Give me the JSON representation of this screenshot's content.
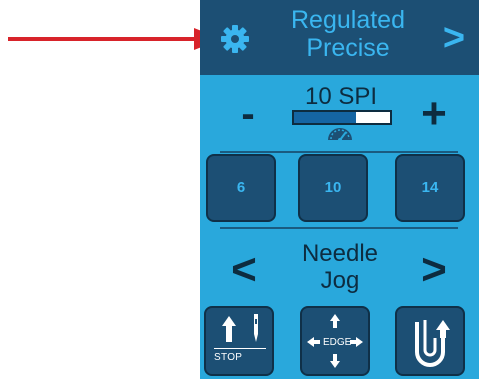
{
  "annotation": {
    "pointer_arrow_color": "#d8232a"
  },
  "colors": {
    "panel_bg": "#29a8dc",
    "button_bg": "#1c4f74",
    "accent_text": "#3ab6f0",
    "dark_text": "#0d2c40"
  },
  "header": {
    "settings_icon": "gear-icon",
    "mode_line1": "Regulated",
    "mode_line2": "Precise",
    "next_label": ">"
  },
  "stitch": {
    "minus_label": "-",
    "plus_label": "+",
    "spi_label": "10 SPI",
    "spi_level_percent": 65,
    "speed_icon": "speedometer-icon"
  },
  "presets": [
    {
      "label": "6"
    },
    {
      "label": "10"
    },
    {
      "label": "14"
    }
  ],
  "jog": {
    "prev_label": "<",
    "next_label": ">",
    "line1": "Needle",
    "line2": "Jog"
  },
  "tools": {
    "needle_stop": {
      "label": "STOP",
      "icon": "needle-up-stop-icon"
    },
    "edge": {
      "label": "EDGE",
      "icon": "edge-arrows-icon"
    },
    "thread_cut": {
      "icon": "thread-cut-icon"
    }
  }
}
